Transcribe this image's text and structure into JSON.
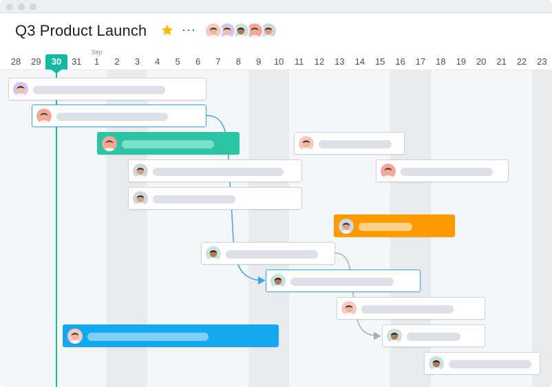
{
  "project": {
    "title": "Q3 Product Launch",
    "star_icon": "star-icon",
    "more_label": "···"
  },
  "colors": {
    "accent": "#14b8a0",
    "green": "#2cc5a3",
    "orange": "#fd9a00",
    "blue": "#14a9ef",
    "link": "#35a8e0"
  },
  "members": [
    {
      "name": "member-1",
      "skin": "#e8b796",
      "hair": "#3b2a20",
      "bg": "#f6c9c3"
    },
    {
      "name": "member-2",
      "skin": "#f0c2a2",
      "hair": "#2d2523",
      "bg": "#d8c6e6"
    },
    {
      "name": "member-3",
      "skin": "#b07a57",
      "hair": "#1f1a17",
      "bg": "#c9e3dc"
    },
    {
      "name": "member-4",
      "skin": "#e6ae8c",
      "hair": "#4a2e1f",
      "bg": "#f4a79c"
    },
    {
      "name": "member-5",
      "skin": "#d9a07d",
      "hair": "#2a2220",
      "bg": "#cfd6e0"
    }
  ],
  "timeline": {
    "month_label": "Sep",
    "today": "30",
    "days": [
      "28",
      "29",
      "30",
      "31",
      "1",
      "2",
      "3",
      "4",
      "5",
      "6",
      "7",
      "8",
      "9",
      "10",
      "11",
      "12",
      "13",
      "14",
      "15",
      "16",
      "17",
      "18",
      "19",
      "20",
      "21",
      "22",
      "23"
    ]
  },
  "tasks": [
    {
      "id": "t1",
      "style": "default",
      "face": 1
    },
    {
      "id": "t2",
      "style": "selected",
      "face": 3
    },
    {
      "id": "t3",
      "style": "green",
      "face": 3
    },
    {
      "id": "t4",
      "style": "default",
      "face": 4
    },
    {
      "id": "t5",
      "style": "default",
      "face": 4
    },
    {
      "id": "t6",
      "style": "default",
      "face": 2
    },
    {
      "id": "t7",
      "style": "selected",
      "face": 2
    },
    {
      "id": "t8",
      "style": "default",
      "face": 0
    },
    {
      "id": "t9",
      "style": "blue",
      "face": 0
    },
    {
      "id": "t10",
      "style": "default",
      "face": 2
    },
    {
      "id": "t11",
      "style": "default",
      "face": 2
    },
    {
      "id": "t12",
      "style": "orange",
      "face": 4
    },
    {
      "id": "t13",
      "style": "default",
      "face": 0
    },
    {
      "id": "t14",
      "style": "default",
      "face": 3
    }
  ]
}
